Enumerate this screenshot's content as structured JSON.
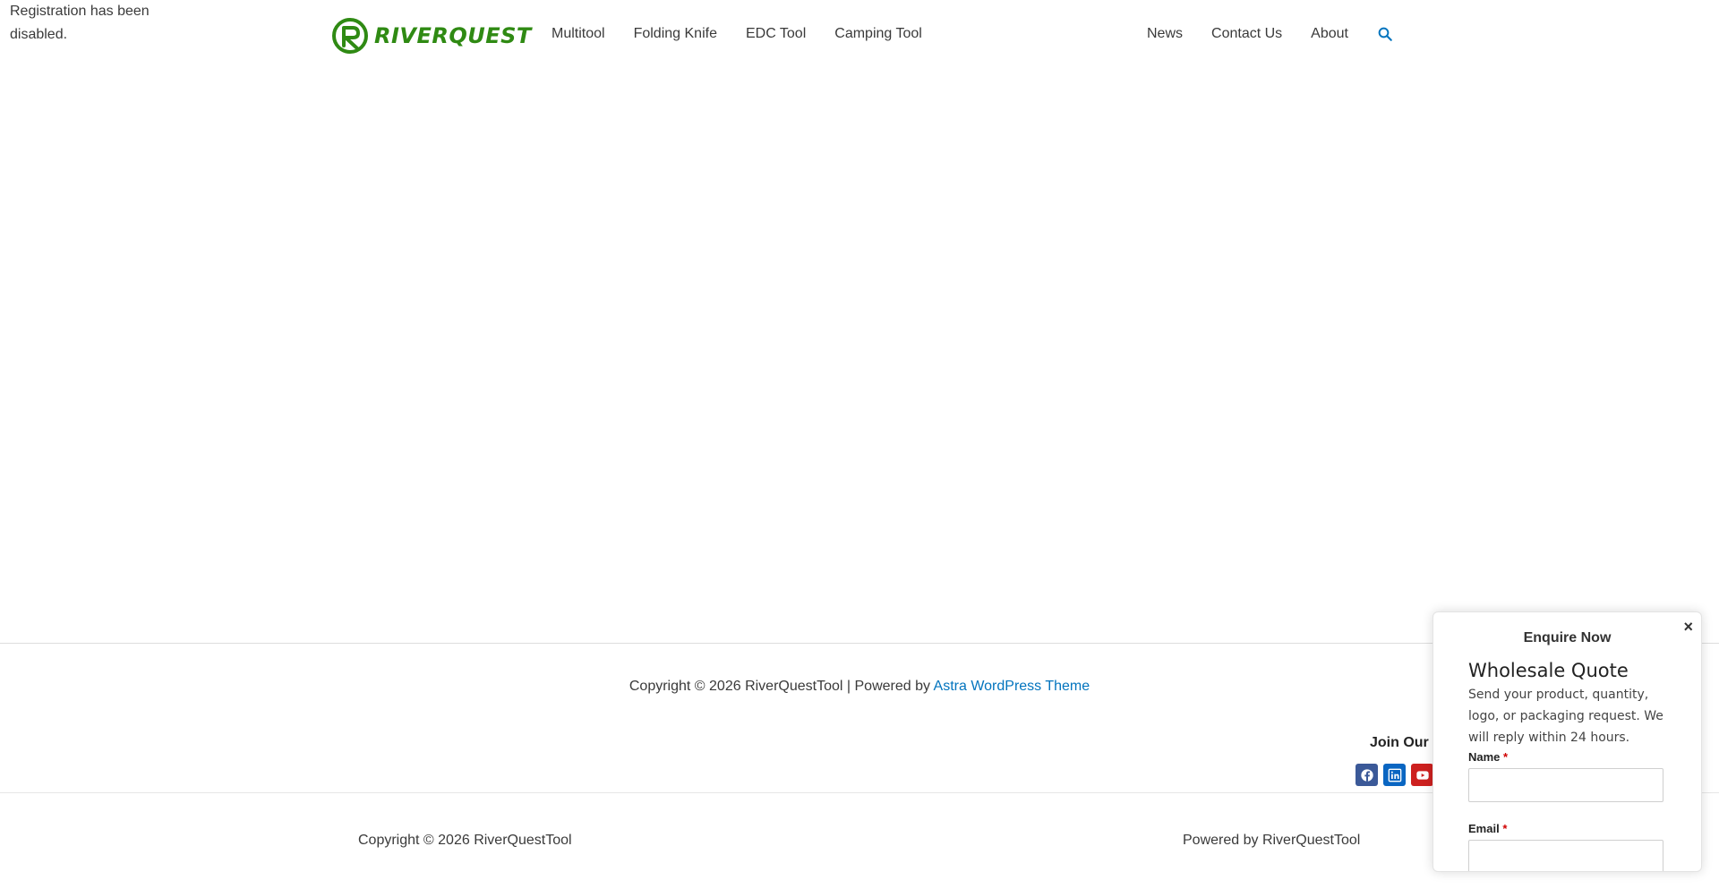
{
  "notice": {
    "text": "Registration has been disabled."
  },
  "header": {
    "logo_text": "RIVERQUEST",
    "nav_left": [
      {
        "label": "Multitool"
      },
      {
        "label": "Folding Knife"
      },
      {
        "label": "EDC Tool"
      },
      {
        "label": "Camping Tool"
      }
    ],
    "nav_right": [
      {
        "label": "News"
      },
      {
        "label": "Contact Us"
      },
      {
        "label": "About"
      }
    ],
    "search_icon": "search-icon"
  },
  "footer": {
    "copyright_prefix": "Copyright © 2026 RiverQuestTool | Powered by",
    "theme_link": "Astra WordPress Theme",
    "join_title": "Join Our",
    "social": [
      "facebook-icon",
      "linkedin-icon",
      "youtube-icon"
    ],
    "bottom_left": "Copyright © 2026 RiverQuestTool",
    "bottom_right": "Powered by RiverQuestTool"
  },
  "popup": {
    "close": "×",
    "title": "Enquire Now",
    "heading": "Wholesale Quote",
    "description": "Send your product, quantity, logo, or packaging request. We will reply within 24 hours.",
    "fields": [
      {
        "label": "Name",
        "required": "*"
      },
      {
        "label": "Email",
        "required": "*"
      }
    ]
  },
  "colors": {
    "brand_green": "#2f8a13",
    "link_blue": "#0274be",
    "required_red": "#d00000"
  }
}
